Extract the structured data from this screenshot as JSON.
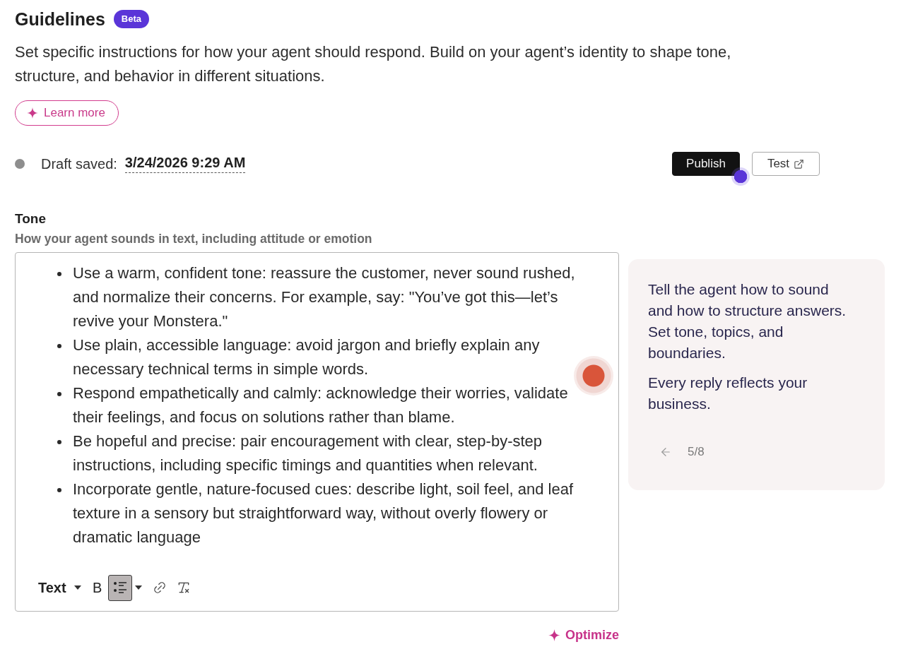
{
  "header": {
    "title": "Guidelines",
    "badge": "Beta",
    "description": "Set specific instructions for how your agent should respond. Build on your agent’s identity to shape tone, structure, and behavior in different situations.",
    "learn_more": {
      "label": "Learn more"
    }
  },
  "draft": {
    "label": "Draft saved:",
    "timestamp": "3/24/2026 9:29 AM"
  },
  "actions": [
    {
      "kind": "primary",
      "label": "Publish"
    },
    {
      "kind": "secondary",
      "label": "Test"
    }
  ],
  "tone": {
    "label": "Tone",
    "hint": "How your agent sounds in text, including attitude or emotion",
    "bullets": [
      "Use a warm, confident tone: reassure the customer, never sound rushed, and normalize their concerns. For example, say: \"You’ve got this—let’s revive your Monstera.\"",
      "Use plain, accessible language: avoid jargon and briefly explain any necessary technical terms in simple words.",
      "Respond empathetically and calmly: acknowledge their worries, validate their feelings, and focus on solutions rather than blame.",
      "Be hopeful and precise: pair encouragement with clear, step-by-step instructions, including specific timings and quantities when relevant.",
      "Incorporate gentle, nature-focused cues: describe light, soil feel, and leaf texture in a sensory but straightforward way, without overly flowery or dramatic language"
    ],
    "toolbar": [
      {
        "kind": "text-style",
        "label": "Text",
        "selected": false
      },
      {
        "kind": "bold",
        "label": "B",
        "selected": false
      },
      {
        "kind": "bullet-list",
        "selected": true
      },
      {
        "kind": "link",
        "selected": false
      },
      {
        "kind": "clear-format",
        "selected": false
      }
    ],
    "optimize": {
      "label": "Optimize"
    }
  },
  "tour": {
    "paragraphs": [
      "Tell the agent how to sound and how to structure answers. Set tone, topics, and boundaries.",
      "Every reply reflects your business."
    ],
    "progress": "5/8"
  }
}
